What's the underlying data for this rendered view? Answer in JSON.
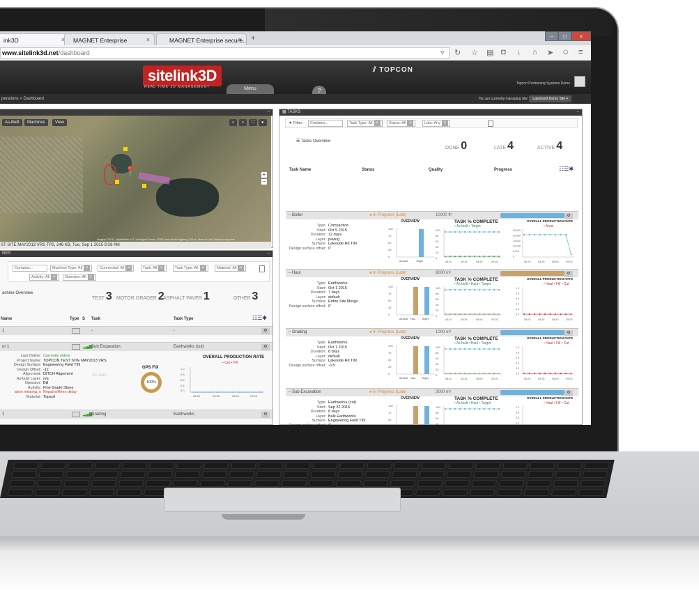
{
  "browser": {
    "tabs": [
      {
        "label": "ink3D",
        "close": "×"
      },
      {
        "label": "MAGNET Enterprise",
        "close": "×"
      },
      {
        "label": "MAGNET Enterprise secure...",
        "close": "×"
      }
    ],
    "new_tab": "+",
    "url_host": "www.sitelink3d.net",
    "url_path": "/dashboard"
  },
  "app": {
    "logo_a": "site",
    "logo_b": "link3D",
    "tagline": "REAL TIME 3D MANAGEMENT",
    "brand": "TOPCON",
    "menu_label": "Menu",
    "help_label": "?",
    "user": "Topcon Positioning Systems Demo",
    "breadcrumb": "perations > Dashboard",
    "managing_text": "You are currently managing site:",
    "site_button": "Lakemont Demo Site"
  },
  "map_panel": {
    "buttons": [
      "As-Built",
      "Machines",
      "View"
    ],
    "status": "ST SITE MAY2013 VRS TP2, 246 KB, Tue, Sep 1 2015 9:28 AM",
    "credit": "Imagery ©2015 , DigitalGlobe, U.S. Geological Survey, USDA Farm Service Agency | 100 m | Terms of Use | Report a map error"
  },
  "machines_panel": {
    "title": "NES",
    "filters": [
      "Contains...",
      "Machine Type: All",
      "Connected: All",
      "Task: All",
      "Task Type: All",
      "Material: All",
      "Activity: All",
      "Operator: All"
    ],
    "overview_label": "achine Overview",
    "stats": [
      {
        "label": "TEST",
        "value": "3"
      },
      {
        "label": "MOTOR GRADER",
        "value": "2"
      },
      {
        "label": "ASPHALT PAVER",
        "value": "1"
      },
      {
        "label": "OTHER",
        "value": "3"
      }
    ],
    "columns": [
      "Name",
      "Type",
      "S",
      "Task",
      "Task Type"
    ],
    "rows": [
      {
        "name": "1",
        "task": "-",
        "task_type": "-"
      },
      {
        "name": "or 1",
        "task": "Sub Excavation",
        "task_type": "Earthworks (cut)"
      },
      {
        "name": "1",
        "task": "Grading",
        "task_type": "Earthworks"
      }
    ],
    "details": [
      {
        "k": "Last Online:",
        "v": "Currently online"
      },
      {
        "k": "Project Name:",
        "v": "TOPCON TEST SITE MAY2013 VRS"
      },
      {
        "k": "Design Surface:",
        "v": "Engineering Field TIN"
      },
      {
        "k": "Design Offset:",
        "v": "-11'"
      },
      {
        "k": "Alignment:",
        "v": "DITCH Alignment"
      },
      {
        "k": "As-built Layer:",
        "v": "n/a"
      },
      {
        "k": "Operator:",
        "v": "Bill"
      },
      {
        "k": "Activity:",
        "v": "Fine Grade Stone"
      },
      {
        "k": "ation missing, o",
        "v": "Repairs/Hires delay"
      },
      {
        "k": "Material:",
        "v": "Topsoil"
      }
    ],
    "no_data": "No data",
    "gps_label": "GPS FIX",
    "gps_value": "100%",
    "rate_title": "OVERALL PRODUCTION RATE",
    "rate_legend": "• Cut • Fill"
  },
  "tasks_panel": {
    "title": "TASKS",
    "filter_label": "Filter:",
    "filters": [
      "Contains...",
      "Task Type: All",
      "Status: All",
      "Late: Any"
    ],
    "overview_label": "Tasks Overview",
    "stats": [
      {
        "label": "DONE",
        "value": "0"
      },
      {
        "label": "LATE",
        "value": "4"
      },
      {
        "label": "ACTIVE",
        "value": "4"
      }
    ],
    "columns": [
      "Task Name",
      "Status",
      "Quality",
      "Progress"
    ],
    "tasks": [
      {
        "name": "Boiler",
        "status": "In Progress (Late)",
        "quality": "10000 ft³",
        "bar_color": "#6db3dc",
        "details": [
          [
            "Type:",
            "Compaction"
          ],
          [
            "Start:",
            "Oct 5 2015"
          ],
          [
            "Duration:",
            "12 days"
          ],
          [
            "Layer:",
            "paving"
          ],
          [
            "Surface:",
            "Lakeside Rd TIN"
          ],
          [
            "Design surface offset:",
            "0'"
          ]
        ],
        "bars": [
          "As-Built",
          "Target"
        ],
        "legend": "• As built • Target",
        "rate_legend": "• Area"
      },
      {
        "name": "Haul",
        "status": "In Progress (Late)",
        "quality": "8000 m³",
        "bar_color": "#c6a36a",
        "details": [
          [
            "Type:",
            "Earthworks"
          ],
          [
            "Start:",
            "Oct 1 2015"
          ],
          [
            "Duration:",
            "7 days"
          ],
          [
            "Layer:",
            "default"
          ],
          [
            "Surface:",
            "Entire Site Merge"
          ],
          [
            "Design surface offset:",
            "0'"
          ]
        ],
        "bars": [
          "As-Built",
          "Haul",
          "Target"
        ],
        "legend": "• As built • Haul • Target",
        "rate_legend": "• Haul • Fill • Cut"
      },
      {
        "name": "Grading",
        "status": "In Progress (Late)",
        "quality": "1000 m³",
        "bar_color": "#6db3dc",
        "details": [
          [
            "Type:",
            "Earthworks"
          ],
          [
            "Start:",
            "Oct 1 2015"
          ],
          [
            "Duration:",
            "8 days"
          ],
          [
            "Layer:",
            "default"
          ],
          [
            "Surface:",
            "Lakeside Rd TIN"
          ],
          [
            "Design surface offset:",
            "-0.5'"
          ]
        ],
        "bars": [
          "As-Built",
          "Haul",
          "Target"
        ],
        "legend": "• As built • Haul • Target",
        "rate_legend": "• Haul • Fill • Cut"
      },
      {
        "name": "Sub Excavation",
        "status": "In Progress (Late)",
        "quality": "3000 m³",
        "bar_color": "#6db3dc",
        "details": [
          [
            "Type:",
            "Earthworks (cut)"
          ],
          [
            "Start:",
            "Sep 22 2015"
          ],
          [
            "Duration:",
            "8 days"
          ],
          [
            "Layer:",
            "Bulk Earthworks"
          ],
          [
            "Surface:",
            "Engineering Field TIN"
          ],
          [
            "Design surface offset:",
            "0'"
          ]
        ],
        "bars": [
          "As-Built",
          "Haul",
          "Target"
        ],
        "legend": "• As built • Haul • Target",
        "rate_legend": "• Haul • Fill • Cut"
      }
    ],
    "chart_titles": [
      "OVERVIEW",
      "TASK % COMPLETE",
      "OVERALL PRODUCTION RATE"
    ],
    "times": [
      "08:20",
      "08:35",
      "08:50",
      "09:05"
    ]
  },
  "colors": {
    "accent_red": "#c32222",
    "status_orange": "#e08a2c",
    "progress_blue": "#6db3dc",
    "progress_tan": "#c6a36a"
  }
}
